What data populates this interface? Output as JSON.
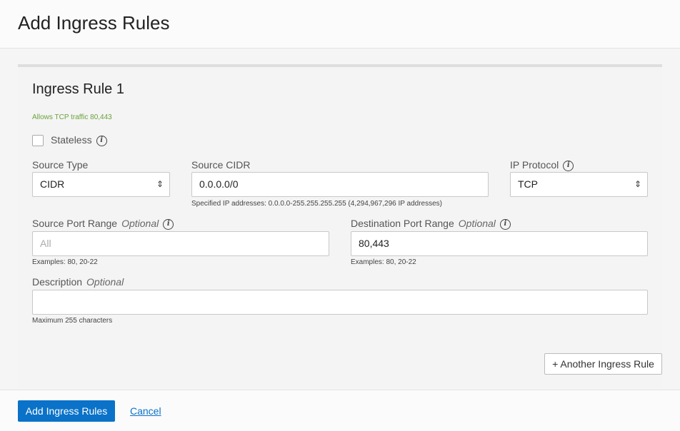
{
  "header": {
    "title": "Add Ingress Rules"
  },
  "rule": {
    "title": "Ingress Rule 1",
    "summary": "Allows TCP traffic 80,443",
    "summary_color": "#6aa33a",
    "stateless_label": "Stateless",
    "stateless_checked": false,
    "source_type": {
      "label": "Source Type",
      "value": "CIDR"
    },
    "source_cidr": {
      "label": "Source CIDR",
      "value": "0.0.0.0/0",
      "help": "Specified IP addresses: 0.0.0.0-255.255.255.255 (4,294,967,296 IP addresses)"
    },
    "ip_protocol": {
      "label": "IP Protocol",
      "value": "TCP"
    },
    "source_port": {
      "label": "Source Port Range",
      "optional": "Optional",
      "placeholder": "All",
      "value": "",
      "help": "Examples: 80, 20-22"
    },
    "dest_port": {
      "label": "Destination Port Range",
      "optional": "Optional",
      "value": "80,443",
      "help": "Examples: 80, 20-22"
    },
    "description": {
      "label": "Description",
      "optional": "Optional",
      "value": "",
      "help": "Maximum 255 characters"
    },
    "another_button": "+ Another Ingress Rule"
  },
  "footer": {
    "submit": "Add Ingress Rules",
    "cancel": "Cancel",
    "accent": "#0a72c8"
  }
}
